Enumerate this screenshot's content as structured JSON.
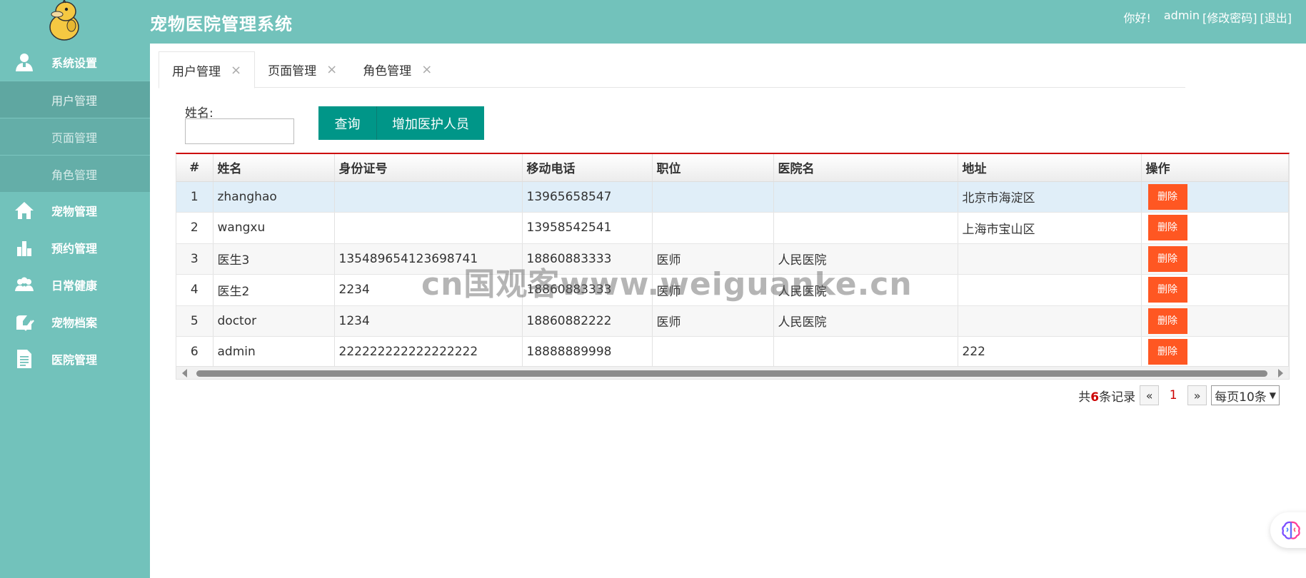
{
  "header": {
    "title": "宠物医院管理系统",
    "greeting": "你好!",
    "username": "admin",
    "change_password": "[修改密码]",
    "logout": "[退出]"
  },
  "sidebar": {
    "items": [
      {
        "label": "系统设置",
        "icon": "user-settings-icon"
      },
      {
        "label": "宠物管理",
        "icon": "home-icon"
      },
      {
        "label": "预约管理",
        "icon": "bar-chart-icon"
      },
      {
        "label": "日常健康",
        "icon": "people-icon"
      },
      {
        "label": "宠物档案",
        "icon": "edit-check-icon"
      },
      {
        "label": "医院管理",
        "icon": "document-icon"
      }
    ],
    "subitems": [
      {
        "label": "用户管理"
      },
      {
        "label": "页面管理"
      },
      {
        "label": "角色管理"
      }
    ]
  },
  "tabs": [
    {
      "label": "用户管理",
      "close": "×"
    },
    {
      "label": "页面管理",
      "close": "×"
    },
    {
      "label": "角色管理",
      "close": "×"
    }
  ],
  "search": {
    "label": "姓名:",
    "value": "",
    "query_button": "查询",
    "add_button": "增加医护人员"
  },
  "table": {
    "headers": [
      "#",
      "姓名",
      "身份证号",
      "移动电话",
      "职位",
      "医院名",
      "地址",
      "操作"
    ],
    "rows": [
      {
        "num": "1",
        "name": "zhanghao",
        "id": "",
        "phone": "13965658547",
        "position": "",
        "hospital": "",
        "address": "北京市海淀区",
        "action": "删除"
      },
      {
        "num": "2",
        "name": "wangxu",
        "id": "",
        "phone": "13958542541",
        "position": "",
        "hospital": "",
        "address": "上海市宝山区",
        "action": "删除"
      },
      {
        "num": "3",
        "name": "医生3",
        "id": "135489654123698741",
        "phone": "18860883333",
        "position": "医师",
        "hospital": "人民医院",
        "address": "",
        "action": "删除"
      },
      {
        "num": "4",
        "name": "医生2",
        "id": "2234",
        "phone": "18860883333",
        "position": "医师",
        "hospital": "人民医院",
        "address": "",
        "action": "删除"
      },
      {
        "num": "5",
        "name": "doctor",
        "id": "1234",
        "phone": "18860882222",
        "position": "医师",
        "hospital": "人民医院",
        "address": "",
        "action": "删除"
      },
      {
        "num": "6",
        "name": "admin",
        "id": "222222222222222222",
        "phone": "18888889998",
        "position": "",
        "hospital": "",
        "address": "222",
        "action": "删除"
      }
    ]
  },
  "pagination": {
    "prefix": "共",
    "total": "6",
    "suffix": "条记录",
    "prev": "«",
    "current": "1",
    "next": "»",
    "per_page": "每页10条"
  },
  "watermark": "cn国观客www.weiguanke.cn",
  "colors": {
    "theme": "#72c2bb",
    "primary_button": "#009688",
    "danger_button": "#ff5722",
    "table_top_border": "#cc0000"
  }
}
